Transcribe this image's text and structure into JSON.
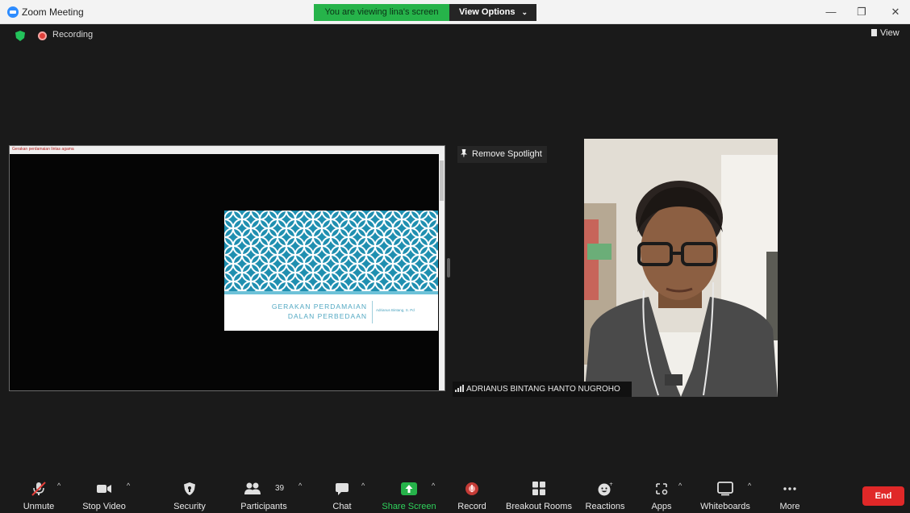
{
  "window": {
    "title": "Zoom Meeting",
    "viewing_banner": "You are viewing lina's screen",
    "view_options_label": "View Options",
    "controls": {
      "minimize": "—",
      "restore": "❐",
      "close": "✕"
    }
  },
  "status": {
    "recording_label": "Recording",
    "view_label": "View"
  },
  "shared_screen": {
    "tab_title": "Gerakan perdamaian lintas agama",
    "slide": {
      "title": "GERAKAN PERDAMAIAN DALAN PERBEDAAN",
      "author": "Adrianus Bintang, S. Pd"
    }
  },
  "spotlight": {
    "remove_label": "Remove Spotlight"
  },
  "participant": {
    "name": "ADRIANUS BINTANG HANTO NUGROHO"
  },
  "toolbar": {
    "items": [
      {
        "label": "Unmute",
        "icon": "muted-mic-icon"
      },
      {
        "label": "Stop Video",
        "icon": "video-camera-icon"
      },
      {
        "label": "Security",
        "icon": "shield-icon"
      },
      {
        "label": "Participants",
        "icon": "participants-icon",
        "count": "39"
      },
      {
        "label": "Chat",
        "icon": "chat-bubble-icon"
      },
      {
        "label": "Share Screen",
        "icon": "share-screen-icon"
      },
      {
        "label": "Record",
        "icon": "record-icon"
      },
      {
        "label": "Breakout Rooms",
        "icon": "breakout-rooms-icon"
      },
      {
        "label": "Reactions",
        "icon": "reactions-icon"
      },
      {
        "label": "Apps",
        "icon": "apps-icon"
      },
      {
        "label": "Whiteboards",
        "icon": "whiteboard-icon"
      },
      {
        "label": "More",
        "icon": "more-dots-icon"
      }
    ],
    "end_label": "End"
  },
  "colors": {
    "share_green": "#26b34a",
    "end_red": "#e02828",
    "slide_teal": "#1f8fb0"
  }
}
